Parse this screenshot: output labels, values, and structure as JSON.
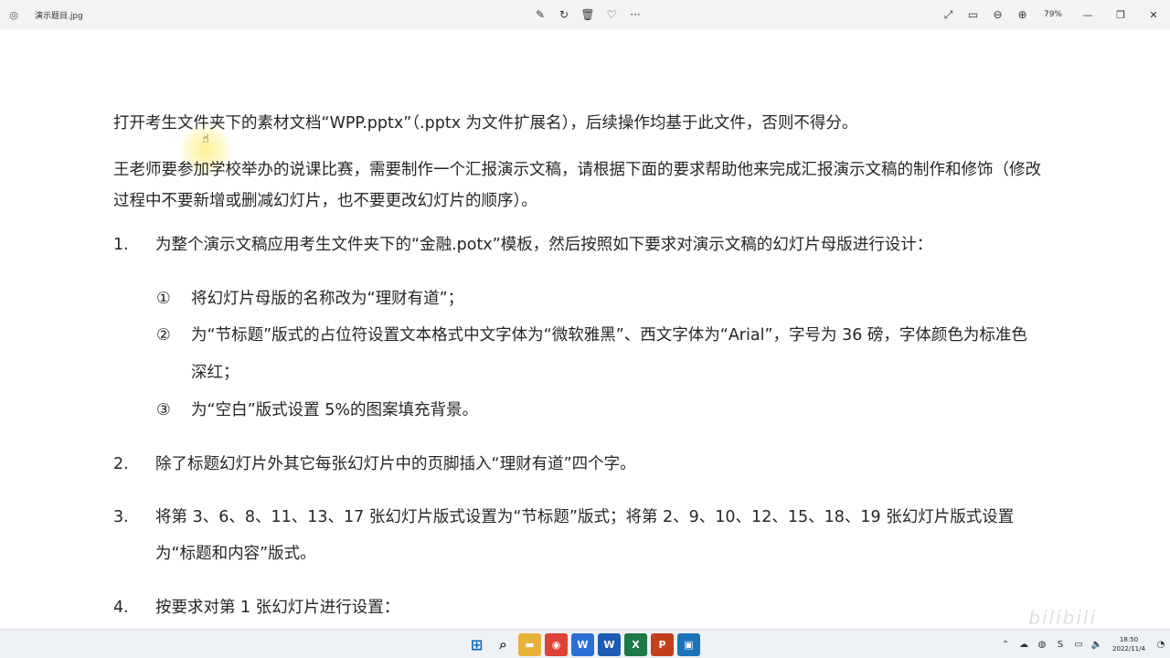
{
  "window": {
    "title": "演示题目.jpg",
    "zoom": "79%",
    "toolbar_icons": [
      "edit-icon",
      "rotate-icon",
      "delete-icon",
      "favorite-icon",
      "more-icon"
    ],
    "right_icons": [
      "fullscreen-icon",
      "fit-icon",
      "zoom-out-icon",
      "zoom-in-icon"
    ]
  },
  "document": {
    "intro": "打开考生文件夹下的素材文档“WPP.pptx”（.pptx 为文件扩展名），后续操作均基于此文件，否则不得分。",
    "description": "王老师要参加学校举办的说课比赛，需要制作一个汇报演示文稿，请根据下面的要求帮助他来完成汇报演示文稿的制作和修饰（修改过程中不要新增或删减幻灯片，也不要更改幻灯片的顺序）。",
    "items": [
      {
        "num": "1.",
        "text": "为整个演示文稿应用考生文件夹下的“金融.potx”模板，然后按照如下要求对演示文稿的幻灯片母版进行设计："
      },
      {
        "num": "2.",
        "text": "除了标题幻灯片外其它每张幻灯片中的页脚插入“理财有道”四个字。"
      },
      {
        "num": "3.",
        "text": "将第 3、6、8、11、13、17 张幻灯片版式设置为“节标题”版式；将第 2、9、10、12、15、18、19 张幻灯片版式设置为“标题和内容”版式。"
      },
      {
        "num": "4.",
        "text": "按要求对第 1 张幻灯片进行设置："
      }
    ],
    "subitems": [
      {
        "num": "①",
        "text": "将幻灯片母版的名称改为“理财有道”；"
      },
      {
        "num": "②",
        "text": "为“节标题”版式的占位符设置文本格式中文字体为“微软雅黑”、西文字体为“Arial”，字号为 36 磅，字体颜色为标准色深红；"
      },
      {
        "num": "③",
        "text": "为“空白”版式设置 5%的图案填充背景。"
      }
    ]
  },
  "taskbar": {
    "apps": [
      {
        "name": "start",
        "glyph": "⊞",
        "color": "#0067c0"
      },
      {
        "name": "search",
        "glyph": "⌕",
        "color": "#333333"
      },
      {
        "name": "file-explorer",
        "glyph": "▬",
        "color": "#e8b13a"
      },
      {
        "name": "chrome",
        "glyph": "◉",
        "color": "#db4437"
      },
      {
        "name": "wps-writer",
        "glyph": "W",
        "color": "#2b6fd6"
      },
      {
        "name": "word",
        "glyph": "W",
        "color": "#1f5bb5"
      },
      {
        "name": "excel",
        "glyph": "X",
        "color": "#1d7a44"
      },
      {
        "name": "powerpoint",
        "glyph": "P",
        "color": "#c43e1c"
      },
      {
        "name": "photos",
        "glyph": "▣",
        "color": "#1a73b8"
      }
    ],
    "time": "18:50",
    "date": "2022/11/4"
  }
}
